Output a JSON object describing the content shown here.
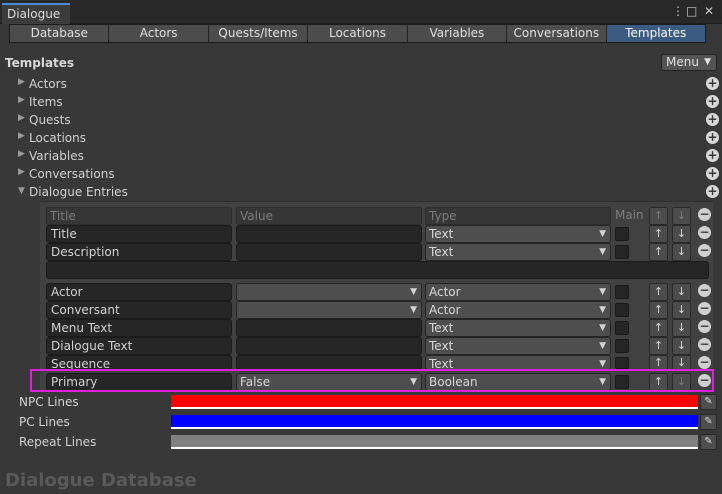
{
  "window": {
    "tab_title": "Dialogue",
    "controls": {
      "more": "⋮",
      "maximize": "□",
      "close": "✕"
    }
  },
  "toolbar": {
    "tabs": [
      {
        "label": "Database",
        "active": false
      },
      {
        "label": "Actors",
        "active": false
      },
      {
        "label": "Quests/Items",
        "active": false
      },
      {
        "label": "Locations",
        "active": false
      },
      {
        "label": "Variables",
        "active": false
      },
      {
        "label": "Conversations",
        "active": false
      },
      {
        "label": "Templates",
        "active": true
      }
    ],
    "active_color": "#3c5b82"
  },
  "templates": {
    "title": "Templates",
    "menu_label": "Menu",
    "foldouts": [
      {
        "label": "Actors",
        "expanded": false
      },
      {
        "label": "Items",
        "expanded": false
      },
      {
        "label": "Quests",
        "expanded": false
      },
      {
        "label": "Locations",
        "expanded": false
      },
      {
        "label": "Variables",
        "expanded": false
      },
      {
        "label": "Conversations",
        "expanded": false
      },
      {
        "label": "Dialogue Entries",
        "expanded": true
      }
    ]
  },
  "fields_table": {
    "headers": {
      "title": "Title",
      "value": "Value",
      "type": "Type",
      "main": "Main"
    },
    "rows": [
      {
        "title": "Title",
        "value": "",
        "value_dropdown": false,
        "type": "Text"
      },
      {
        "title": "Description",
        "value": "",
        "value_dropdown": false,
        "type": "Text"
      },
      {
        "title": "Actor",
        "value": "",
        "value_dropdown": true,
        "type": "Actor"
      },
      {
        "title": "Conversant",
        "value": "",
        "value_dropdown": true,
        "type": "Actor"
      },
      {
        "title": "Menu Text",
        "value": "",
        "value_dropdown": false,
        "type": "Text"
      },
      {
        "title": "Dialogue Text",
        "value": "",
        "value_dropdown": false,
        "type": "Text"
      },
      {
        "title": "Sequence",
        "value": "",
        "value_dropdown": false,
        "type": "Text"
      },
      {
        "title": "Primary",
        "value": "False",
        "value_dropdown": true,
        "type": "Boolean"
      }
    ],
    "highlight_color": "#e020e0"
  },
  "colors": {
    "rows": [
      {
        "label": "NPC Lines",
        "color": "#ff0000"
      },
      {
        "label": "PC Lines",
        "color": "#0000ff"
      },
      {
        "label": "Repeat Lines",
        "color": "#808080"
      }
    ]
  },
  "footer": {
    "label": "Dialogue Database"
  }
}
